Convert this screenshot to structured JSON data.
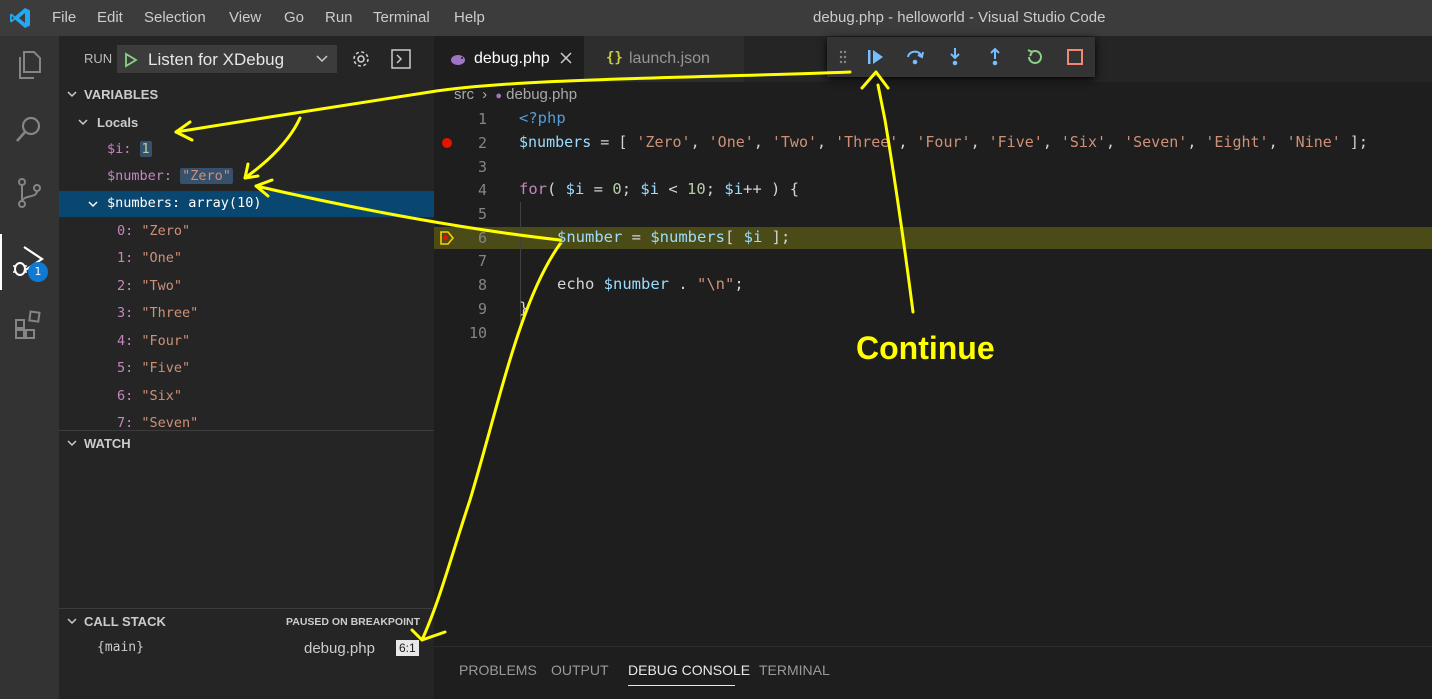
{
  "window_title": "debug.php - helloworld - Visual Studio Code",
  "menu": [
    "File",
    "Edit",
    "Selection",
    "View",
    "Go",
    "Run",
    "Terminal",
    "Help"
  ],
  "activity": {
    "debug_badge": "1"
  },
  "run": {
    "label": "RUN",
    "config": "Listen for XDebug"
  },
  "variables": {
    "title": "VARIABLES",
    "locals_label": "Locals",
    "i_name": "$i:",
    "i_value": "1",
    "number_name": "$number:",
    "number_value": "\"Zero\"",
    "numbers_name": "$numbers:",
    "numbers_value": "array(10)",
    "items": [
      {
        "key": "0:",
        "value": "\"Zero\""
      },
      {
        "key": "1:",
        "value": "\"One\""
      },
      {
        "key": "2:",
        "value": "\"Two\""
      },
      {
        "key": "3:",
        "value": "\"Three\""
      },
      {
        "key": "4:",
        "value": "\"Four\""
      },
      {
        "key": "5:",
        "value": "\"Five\""
      },
      {
        "key": "6:",
        "value": "\"Six\""
      },
      {
        "key": "7:",
        "value": "\"Seven\""
      }
    ]
  },
  "watch": {
    "title": "WATCH"
  },
  "callstack": {
    "title": "CALL STACK",
    "status": "PAUSED ON BREAKPOINT",
    "frame": "{main}",
    "file": "debug.php",
    "position": "6:1"
  },
  "tabs": [
    {
      "label": "debug.php"
    },
    {
      "label": "launch.json"
    }
  ],
  "breadcrumb": {
    "folder": "src",
    "file": "debug.php"
  },
  "line_numbers": [
    "1",
    "2",
    "3",
    "4",
    "5",
    "6",
    "7",
    "8",
    "9",
    "10"
  ],
  "code": {
    "l1": "<?php",
    "l2_var": "$numbers",
    "l2_eq": " = [ ",
    "l2_strs": [
      "'Zero'",
      "'One'",
      "'Two'",
      "'Three'",
      "'Four'",
      "'Five'",
      "'Six'",
      "'Seven'",
      "'Eight'",
      "'Nine'"
    ],
    "l2_end": " ];",
    "l4_for": "for",
    "l4_open": "( ",
    "l4_i": "$i",
    "l4_eq": " = ",
    "l4_zero": "0",
    "l4_semi1": "; ",
    "l4_i2": "$i",
    "l4_lt": " < ",
    "l4_ten": "10",
    "l4_semi2": "; ",
    "l4_i3": "$i",
    "l4_inc": "++ ) {",
    "l6_var": "$number",
    "l6_eq": " = ",
    "l6_arr": "$numbers",
    "l6_idx_open": "[ ",
    "l6_i": "$i",
    "l6_idx_close": " ];",
    "l8_echo": "echo ",
    "l8_var": "$number",
    "l8_dot": " . ",
    "l8_str": "\"\\n\"",
    "l8_semi": ";",
    "l9": "}"
  },
  "panel_tabs": [
    "PROBLEMS",
    "OUTPUT",
    "DEBUG CONSOLE",
    "TERMINAL"
  ],
  "annotation": {
    "continue_label": "Continue"
  },
  "colors": {
    "accent": "#0e7ad3",
    "annotation": "#ffff00",
    "breakpoint": "#e51400"
  }
}
